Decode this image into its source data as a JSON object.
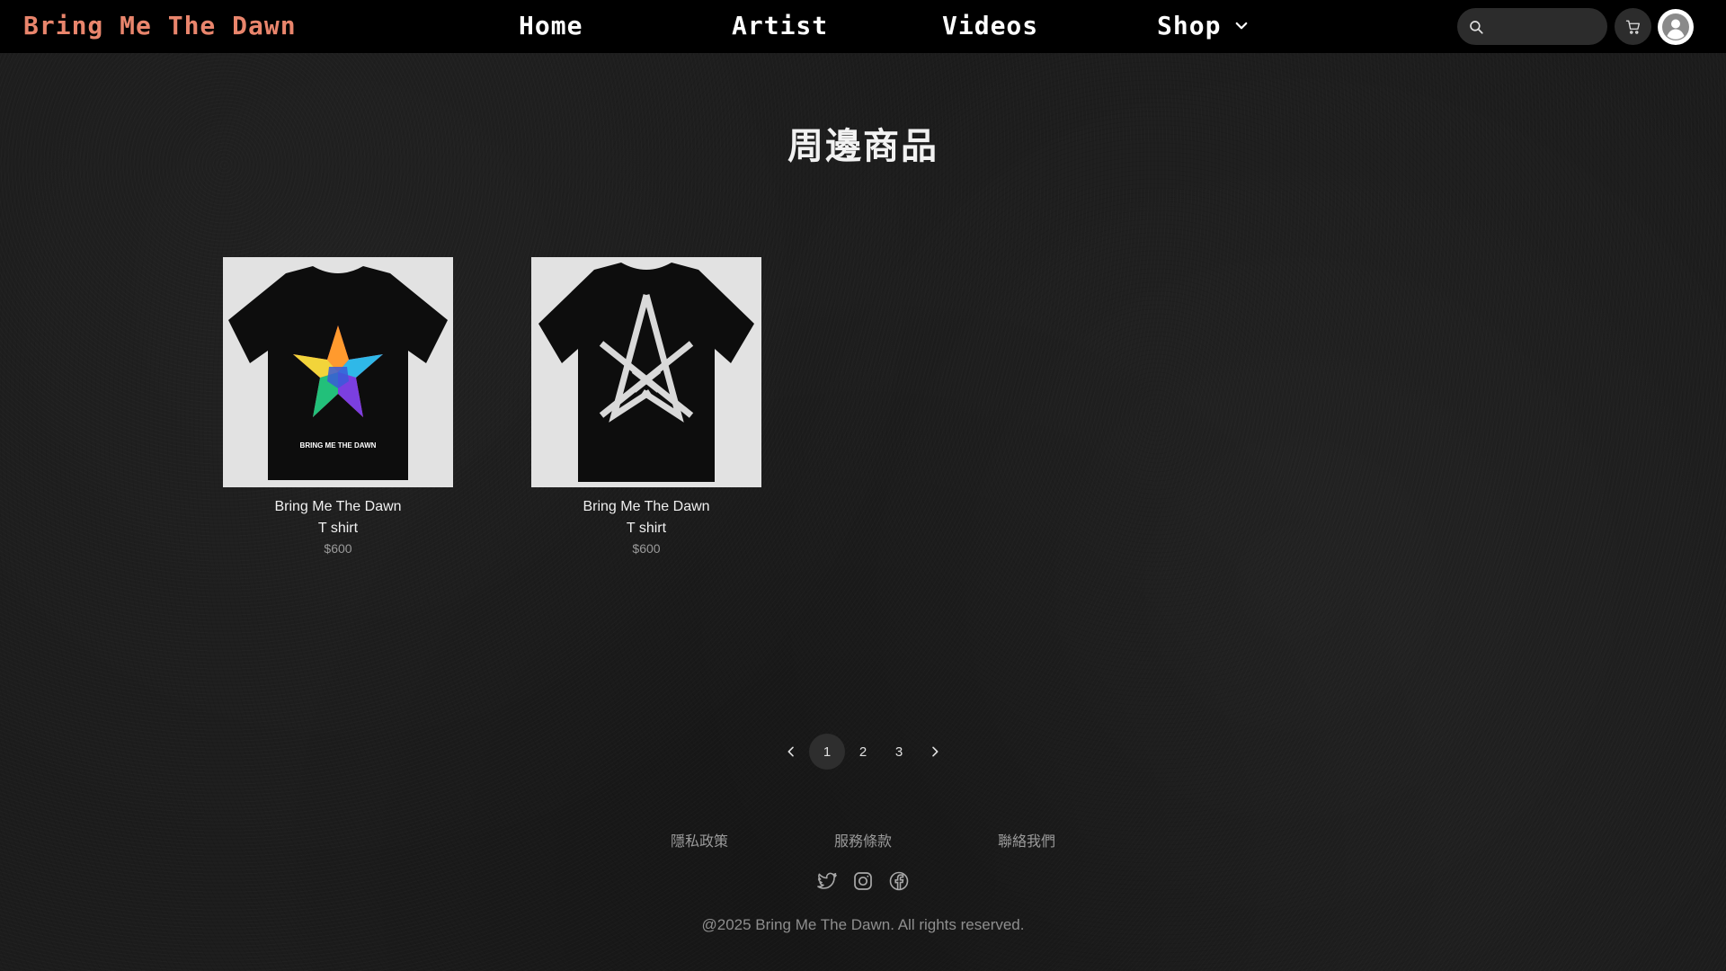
{
  "header": {
    "brand": "Bring Me The Dawn",
    "nav": {
      "home": "Home",
      "artist": "Artist",
      "videos": "Videos",
      "shop": "Shop"
    },
    "search": {
      "placeholder": "",
      "value": ""
    },
    "icons": [
      "search-icon",
      "cart-icon",
      "user-icon",
      "chevron-down-icon"
    ]
  },
  "page": {
    "title": "周邊商品"
  },
  "products": [
    {
      "name_line1": "Bring Me The Dawn",
      "name_line2": "T shirt",
      "price": "$600",
      "shirt_print": "BRING ME THE DAWN"
    },
    {
      "name_line1": "Bring Me The Dawn",
      "name_line2": "T shirt",
      "price": "$600"
    }
  ],
  "pagination": {
    "pages": [
      "1",
      "2",
      "3"
    ],
    "current": "1"
  },
  "footer": {
    "links": {
      "privacy": "隱私政策",
      "terms": "服務條款",
      "contact": "聯絡我們"
    },
    "socials": [
      "twitter-icon",
      "instagram-icon",
      "facebook-icon"
    ],
    "copyright": "@2025 Bring Me The Dawn. All rights reserved."
  },
  "colors": {
    "brand": "#e9856c",
    "nav_bg": "#000000",
    "page_bg": "#1c1c1c"
  }
}
